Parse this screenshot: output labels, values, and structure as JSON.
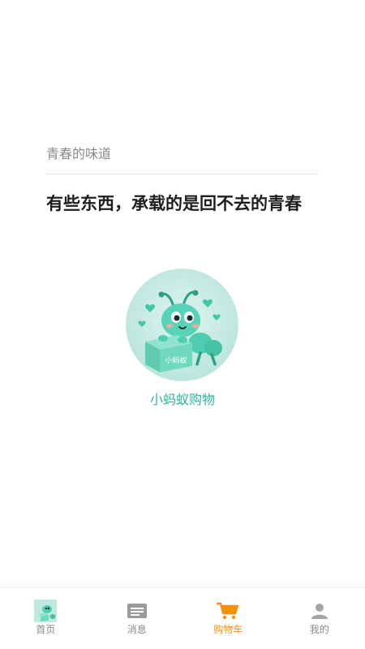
{
  "content": {
    "subtitle": "青春的味道",
    "headline": "有些东西，承载的是回不去的青春",
    "logo_box_text": "小蚂蚁",
    "logo_caption": "小蚂蚁购物"
  },
  "tabbar": {
    "active_index": 2,
    "active_color": "#f7900f",
    "inactive_color": "#8a8a8a",
    "items": [
      {
        "label": "首页",
        "icon": "home-thumbnail-icon"
      },
      {
        "label": "消息",
        "icon": "message-icon"
      },
      {
        "label": "购物车",
        "icon": "cart-icon"
      },
      {
        "label": "我的",
        "icon": "user-icon"
      }
    ]
  }
}
